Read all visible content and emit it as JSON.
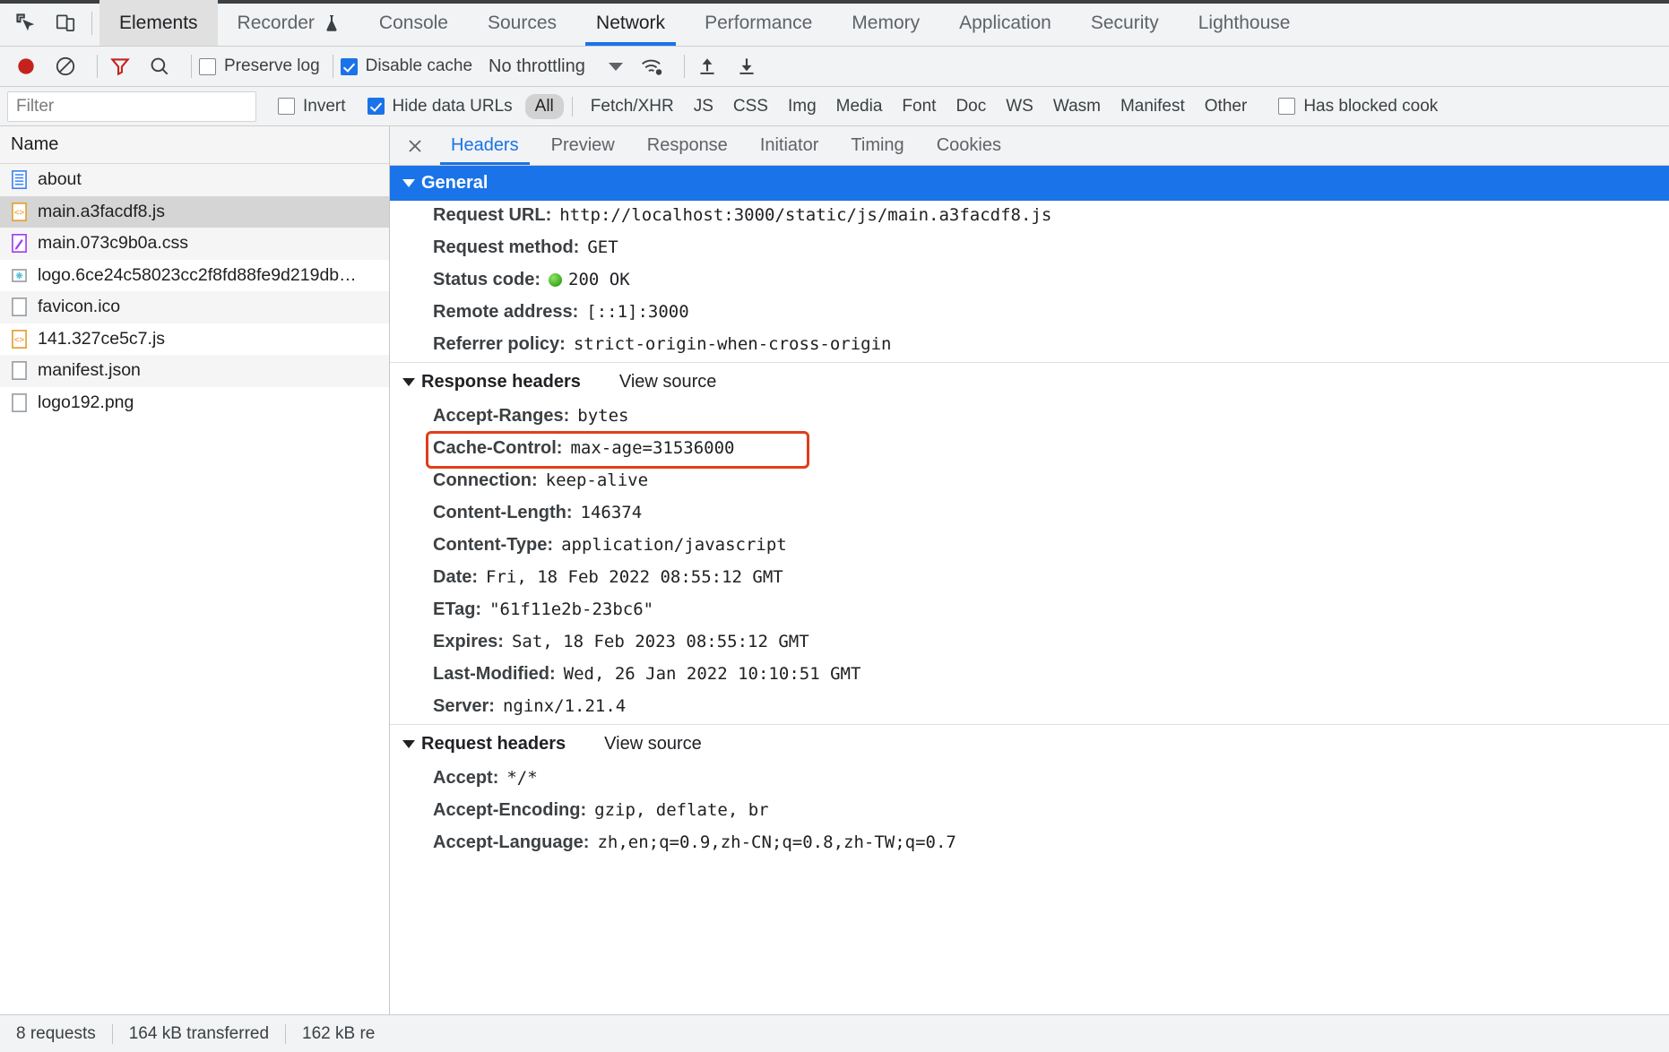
{
  "devtools": {
    "tools": [
      {
        "name": "inspect-element-icon",
        "label": "Inspect"
      },
      {
        "name": "device-toolbar-icon",
        "label": "Toggle device toolbar"
      }
    ],
    "tabs": [
      {
        "label": "Elements",
        "state": "selected-panel"
      },
      {
        "label": "Recorder",
        "state": "normal",
        "badge": "flask-icon"
      },
      {
        "label": "Console",
        "state": "normal"
      },
      {
        "label": "Sources",
        "state": "normal"
      },
      {
        "label": "Network",
        "state": "active-underline"
      },
      {
        "label": "Performance",
        "state": "normal"
      },
      {
        "label": "Memory",
        "state": "normal"
      },
      {
        "label": "Application",
        "state": "normal"
      },
      {
        "label": "Security",
        "state": "normal"
      },
      {
        "label": "Lighthouse",
        "state": "normal"
      }
    ]
  },
  "toolbar": {
    "record_icon": "record-button-icon",
    "clear_icon": "clear-network-log-icon",
    "filter_icon": "filter-funnel-icon",
    "search_icon": "search-icon",
    "preserve_log": {
      "label": "Preserve log",
      "checked": false
    },
    "disable_cache": {
      "label": "Disable cache",
      "checked": true
    },
    "throttling": "No throttling",
    "network_conditions_icon": "wifi-settings-icon",
    "import_icon": "upload-har-icon",
    "export_icon": "download-har-icon"
  },
  "filterbar": {
    "filter_placeholder": "Filter",
    "filter_value": "",
    "invert": {
      "label": "Invert",
      "checked": false
    },
    "hide_data_urls": {
      "label": "Hide data URLs",
      "checked": true
    },
    "types": [
      {
        "label": "All",
        "active": true
      },
      {
        "label": "Fetch/XHR",
        "active": false
      },
      {
        "label": "JS",
        "active": false
      },
      {
        "label": "CSS",
        "active": false
      },
      {
        "label": "Img",
        "active": false
      },
      {
        "label": "Media",
        "active": false
      },
      {
        "label": "Font",
        "active": false
      },
      {
        "label": "Doc",
        "active": false
      },
      {
        "label": "WS",
        "active": false
      },
      {
        "label": "Wasm",
        "active": false
      },
      {
        "label": "Manifest",
        "active": false
      },
      {
        "label": "Other",
        "active": false
      }
    ],
    "has_blocked_cookies": {
      "label": "Has blocked cook",
      "checked": false
    }
  },
  "requests": {
    "column_header": "Name",
    "rows": [
      {
        "name": "about",
        "icon": "document-icon",
        "selected": false
      },
      {
        "name": "main.a3facdf8.js",
        "icon": "script-icon",
        "selected": true
      },
      {
        "name": "main.073c9b0a.css",
        "icon": "stylesheet-icon",
        "selected": false
      },
      {
        "name": "logo.6ce24c58023cc2f8fd88fe9d219db…",
        "icon": "image-icon",
        "selected": false
      },
      {
        "name": "favicon.ico",
        "icon": "generic-file-icon",
        "selected": false
      },
      {
        "name": "141.327ce5c7.js",
        "icon": "script-icon",
        "selected": false
      },
      {
        "name": "manifest.json",
        "icon": "generic-file-icon",
        "selected": false
      },
      {
        "name": "logo192.png",
        "icon": "generic-file-icon",
        "selected": false
      }
    ]
  },
  "details": {
    "close_icon": "close-icon",
    "tabs": [
      {
        "label": "Headers",
        "active": true
      },
      {
        "label": "Preview",
        "active": false
      },
      {
        "label": "Response",
        "active": false
      },
      {
        "label": "Initiator",
        "active": false
      },
      {
        "label": "Timing",
        "active": false
      },
      {
        "label": "Cookies",
        "active": false
      }
    ],
    "general": {
      "title": "General",
      "rows": [
        {
          "key": "Request URL:",
          "value": "http://localhost:3000/static/js/main.a3facdf8.js"
        },
        {
          "key": "Request method:",
          "value": "GET"
        },
        {
          "key": "Status code:",
          "value": "200 OK",
          "status_dot": "green"
        },
        {
          "key": "Remote address:",
          "value": "[::1]:3000"
        },
        {
          "key": "Referrer policy:",
          "value": "strict-origin-when-cross-origin"
        }
      ]
    },
    "response_headers": {
      "title": "Response headers",
      "view_source": "View source",
      "rows": [
        {
          "key": "Accept-Ranges:",
          "value": "bytes"
        },
        {
          "key": "Cache-Control:",
          "value": "max-age=31536000",
          "highlighted": true
        },
        {
          "key": "Connection:",
          "value": "keep-alive"
        },
        {
          "key": "Content-Length:",
          "value": "146374"
        },
        {
          "key": "Content-Type:",
          "value": "application/javascript"
        },
        {
          "key": "Date:",
          "value": "Fri, 18 Feb 2022 08:55:12 GMT"
        },
        {
          "key": "ETag:",
          "value": "\"61f11e2b-23bc6\""
        },
        {
          "key": "Expires:",
          "value": "Sat, 18 Feb 2023 08:55:12 GMT"
        },
        {
          "key": "Last-Modified:",
          "value": "Wed, 26 Jan 2022 10:10:51 GMT"
        },
        {
          "key": "Server:",
          "value": "nginx/1.21.4"
        }
      ]
    },
    "request_headers": {
      "title": "Request headers",
      "view_source": "View source",
      "rows": [
        {
          "key": "Accept:",
          "value": "*/*"
        },
        {
          "key": "Accept-Encoding:",
          "value": "gzip, deflate, br"
        },
        {
          "key": "Accept-Language:",
          "value": "zh,en;q=0.9,zh-CN;q=0.8,zh-TW;q=0.7"
        }
      ]
    },
    "highlight_color": "#e03e1a"
  },
  "footer": {
    "requests": "8 requests",
    "transferred": "164 kB transferred",
    "resources": "162 kB re"
  }
}
